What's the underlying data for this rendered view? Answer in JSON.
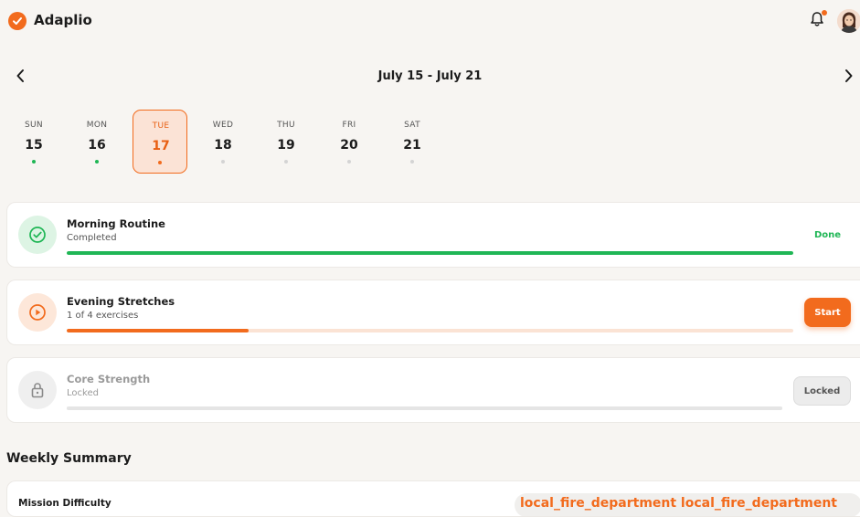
{
  "app": {
    "title": "Adaplio"
  },
  "week": {
    "range": "July 15 - July 21"
  },
  "days": [
    {
      "name": "SUN",
      "num": "15",
      "status": "done"
    },
    {
      "name": "MON",
      "num": "16",
      "status": "done"
    },
    {
      "name": "TUE",
      "num": "17",
      "status": "selected"
    },
    {
      "name": "WED",
      "num": "18",
      "status": "upcoming"
    },
    {
      "name": "THU",
      "num": "19",
      "status": "upcoming"
    },
    {
      "name": "FRI",
      "num": "20",
      "status": "upcoming"
    },
    {
      "name": "SAT",
      "num": "21",
      "status": "upcoming"
    }
  ],
  "routines": [
    {
      "title": "Morning Routine",
      "subtitle": "Completed",
      "progress": 1.0,
      "action": "Done",
      "icon": "check-circle-icon"
    },
    {
      "title": "Evening Stretches",
      "subtitle": "1 of 4 exercises",
      "progress": 0.25,
      "action": "Start",
      "icon": "play-circle-icon"
    },
    {
      "title": "Core Strength",
      "subtitle": "Locked",
      "progress": 0.0,
      "action": "Locked",
      "icon": "lock-icon"
    }
  ],
  "summary": {
    "title": "Weekly Summary",
    "label": "Mission Difficulty",
    "value": "local_fire_department local_fire_department"
  },
  "colors": {
    "accent": "#f26b1d",
    "success": "#1fb655",
    "background": "#f7f5f2"
  },
  "icons": {
    "logo": "check-badge-icon",
    "notifications": "bell-icon",
    "prev": "chevron-left-icon",
    "next": "chevron-right-icon"
  }
}
